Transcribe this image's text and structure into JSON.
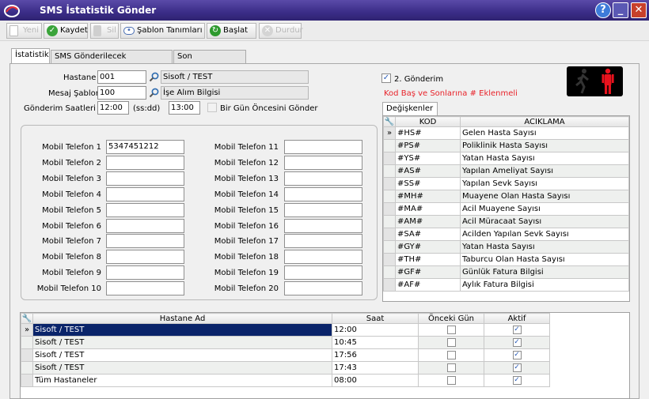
{
  "window": {
    "title": "SMS İstatistik Gönder"
  },
  "toolbar": {
    "new_label": "Yeni",
    "save_label": "Kaydet",
    "delete_label": "Sil",
    "templates_label": "Şablon Tanımları",
    "start_label": "Başlat",
    "stop_label": "Durdur"
  },
  "tabs": [
    {
      "label": "İstatistik"
    },
    {
      "label": "SMS Gönderilecek Personeller"
    },
    {
      "label": "Son Gönderimler"
    }
  ],
  "form": {
    "hastane_label": "Hastane",
    "hastane_code": "001",
    "hastane_name": "Sisoft / TEST",
    "sablon_label": "Mesaj Şablonu",
    "sablon_code": "100",
    "sablon_name": "İşe Alım Bilgisi",
    "saat_label": "Gönderim Saatleri",
    "saat_start": "12:00",
    "saat_format": "(ss:dd)",
    "saat_end": "13:00",
    "onceki_gun_label": "Bir Gün Öncesini Gönder",
    "ikinci_gonderim_label": "2. Gönderim",
    "kod_warning": "Kod Baş ve Sonlarına # Eklenmeli",
    "degiskenler_tab": "Değişkenler"
  },
  "phones_left": [
    {
      "label": "Mobil Telefon 1",
      "value": "5347451212"
    },
    {
      "label": "Mobil Telefon 2",
      "value": ""
    },
    {
      "label": "Mobil Telefon 3",
      "value": ""
    },
    {
      "label": "Mobil Telefon 4",
      "value": ""
    },
    {
      "label": "Mobil Telefon 5",
      "value": ""
    },
    {
      "label": "Mobil Telefon 6",
      "value": ""
    },
    {
      "label": "Mobil Telefon 7",
      "value": ""
    },
    {
      "label": "Mobil Telefon 8",
      "value": ""
    },
    {
      "label": "Mobil Telefon 9",
      "value": ""
    },
    {
      "label": "Mobil Telefon 10",
      "value": ""
    }
  ],
  "phones_right": [
    {
      "label": "Mobil Telefon 11",
      "value": ""
    },
    {
      "label": "Mobil Telefon 12",
      "value": ""
    },
    {
      "label": "Mobil Telefon 13",
      "value": ""
    },
    {
      "label": "Mobil Telefon 14",
      "value": ""
    },
    {
      "label": "Mobil Telefon 15",
      "value": ""
    },
    {
      "label": "Mobil Telefon 16",
      "value": ""
    },
    {
      "label": "Mobil Telefon 17",
      "value": ""
    },
    {
      "label": "Mobil Telefon 18",
      "value": ""
    },
    {
      "label": "Mobil Telefon 19",
      "value": ""
    },
    {
      "label": "Mobil Telefon 20",
      "value": ""
    }
  ],
  "variables": {
    "headers": [
      "KOD",
      "ACIKLAMA"
    ],
    "rows": [
      {
        "kod": "#HS#",
        "aciklama": "Gelen Hasta Sayısı"
      },
      {
        "kod": "#PS#",
        "aciklama": "Poliklinik Hasta Sayısı"
      },
      {
        "kod": "#YS#",
        "aciklama": "Yatan Hasta Sayısı"
      },
      {
        "kod": "#AS#",
        "aciklama": "Yapılan Ameliyat Sayısı"
      },
      {
        "kod": "#SS#",
        "aciklama": "Yapılan Sevk Sayısı"
      },
      {
        "kod": "#MH#",
        "aciklama": "Muayene Olan Hasta Sayısı"
      },
      {
        "kod": "#MA#",
        "aciklama": "Acil Muayene Sayısı"
      },
      {
        "kod": "#AM#",
        "aciklama": "Acil Müracaat Sayısı"
      },
      {
        "kod": "#SA#",
        "aciklama": "Acilden Yapılan Sevk Sayısı"
      },
      {
        "kod": "#GY#",
        "aciklama": "Yatan Hasta Sayısı"
      },
      {
        "kod": "#TH#",
        "aciklama": "Taburcu Olan Hasta Sayısı"
      },
      {
        "kod": "#GF#",
        "aciklama": "Günlük Fatura Bilgisi"
      },
      {
        "kod": "#AF#",
        "aciklama": "Aylık Fatura Bilgisi"
      }
    ]
  },
  "schedule": {
    "headers": [
      "Hastane Ad",
      "Saat",
      "Önceki Gün",
      "Aktif"
    ],
    "rows": [
      {
        "hastane": "Sisoft / TEST",
        "saat": "12:00",
        "onceki": false,
        "aktif": true
      },
      {
        "hastane": "Sisoft / TEST",
        "saat": "10:45",
        "onceki": false,
        "aktif": true
      },
      {
        "hastane": "Sisoft / TEST",
        "saat": "17:56",
        "onceki": false,
        "aktif": true
      },
      {
        "hastane": "Sisoft / TEST",
        "saat": "17:43",
        "onceki": false,
        "aktif": true
      },
      {
        "hastane": "Tüm Hastaneler",
        "saat": "08:00",
        "onceki": false,
        "aktif": true
      }
    ]
  },
  "colors": {
    "title_bar": "#3b2d88",
    "warning": "#e8232a",
    "selection": "#0a246a",
    "signal_red": "#e8121d"
  }
}
